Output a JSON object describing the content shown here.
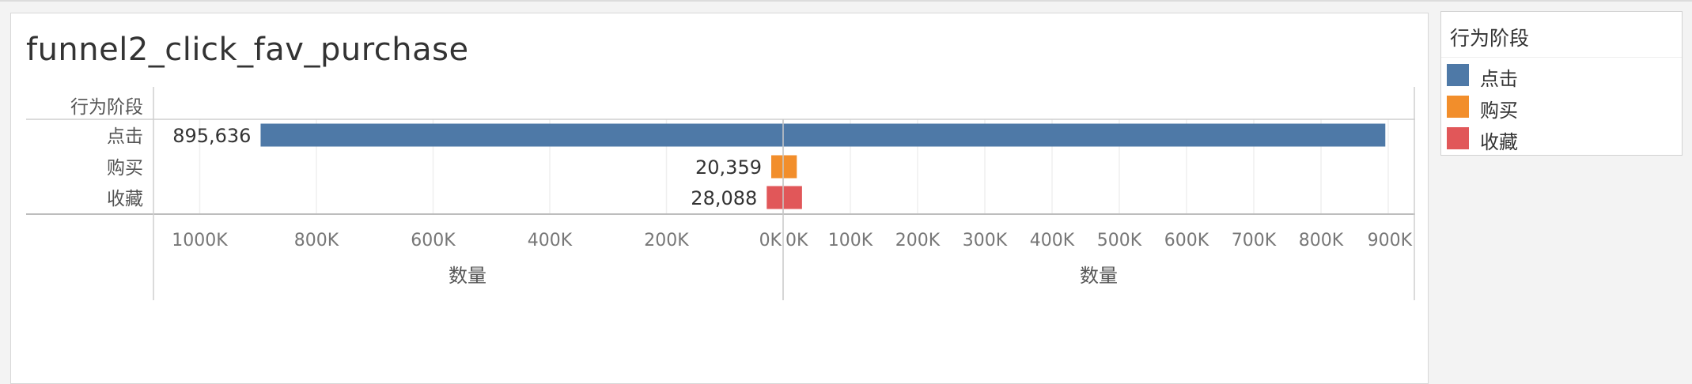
{
  "worksheet": {
    "title": "funnel2_click_fav_purchase"
  },
  "legend": {
    "title": "行为阶段",
    "items": [
      {
        "label": "点击",
        "color": "#4e79a7"
      },
      {
        "label": "购买",
        "color": "#f28e2b"
      },
      {
        "label": "收藏",
        "color": "#e15759"
      }
    ]
  },
  "chart_data": {
    "type": "bar",
    "orientation": "horizontal",
    "layout": "butterfly-funnel",
    "row_header": "行为阶段",
    "categories": [
      "点击",
      "购买",
      "收藏"
    ],
    "values": [
      895636,
      20359,
      28088
    ],
    "value_labels": [
      "895,636",
      "20,359",
      "28,088"
    ],
    "colors": [
      "#4e79a7",
      "#f28e2b",
      "#e15759"
    ],
    "left_axis": {
      "label": "数量",
      "reversed": true,
      "range": [
        0,
        1000000
      ],
      "ticks": [
        1000000,
        800000,
        600000,
        400000,
        200000,
        0
      ],
      "tick_labels": [
        "1000K",
        "800K",
        "600K",
        "400K",
        "200K",
        "0K"
      ]
    },
    "right_axis": {
      "label": "数量",
      "range": [
        0,
        900000
      ],
      "ticks": [
        0,
        100000,
        200000,
        300000,
        400000,
        500000,
        600000,
        700000,
        800000,
        900000
      ],
      "tick_labels": [
        "0K",
        "100K",
        "200K",
        "300K",
        "400K",
        "500K",
        "600K",
        "700K",
        "800K",
        "900K"
      ]
    },
    "grid": true
  }
}
